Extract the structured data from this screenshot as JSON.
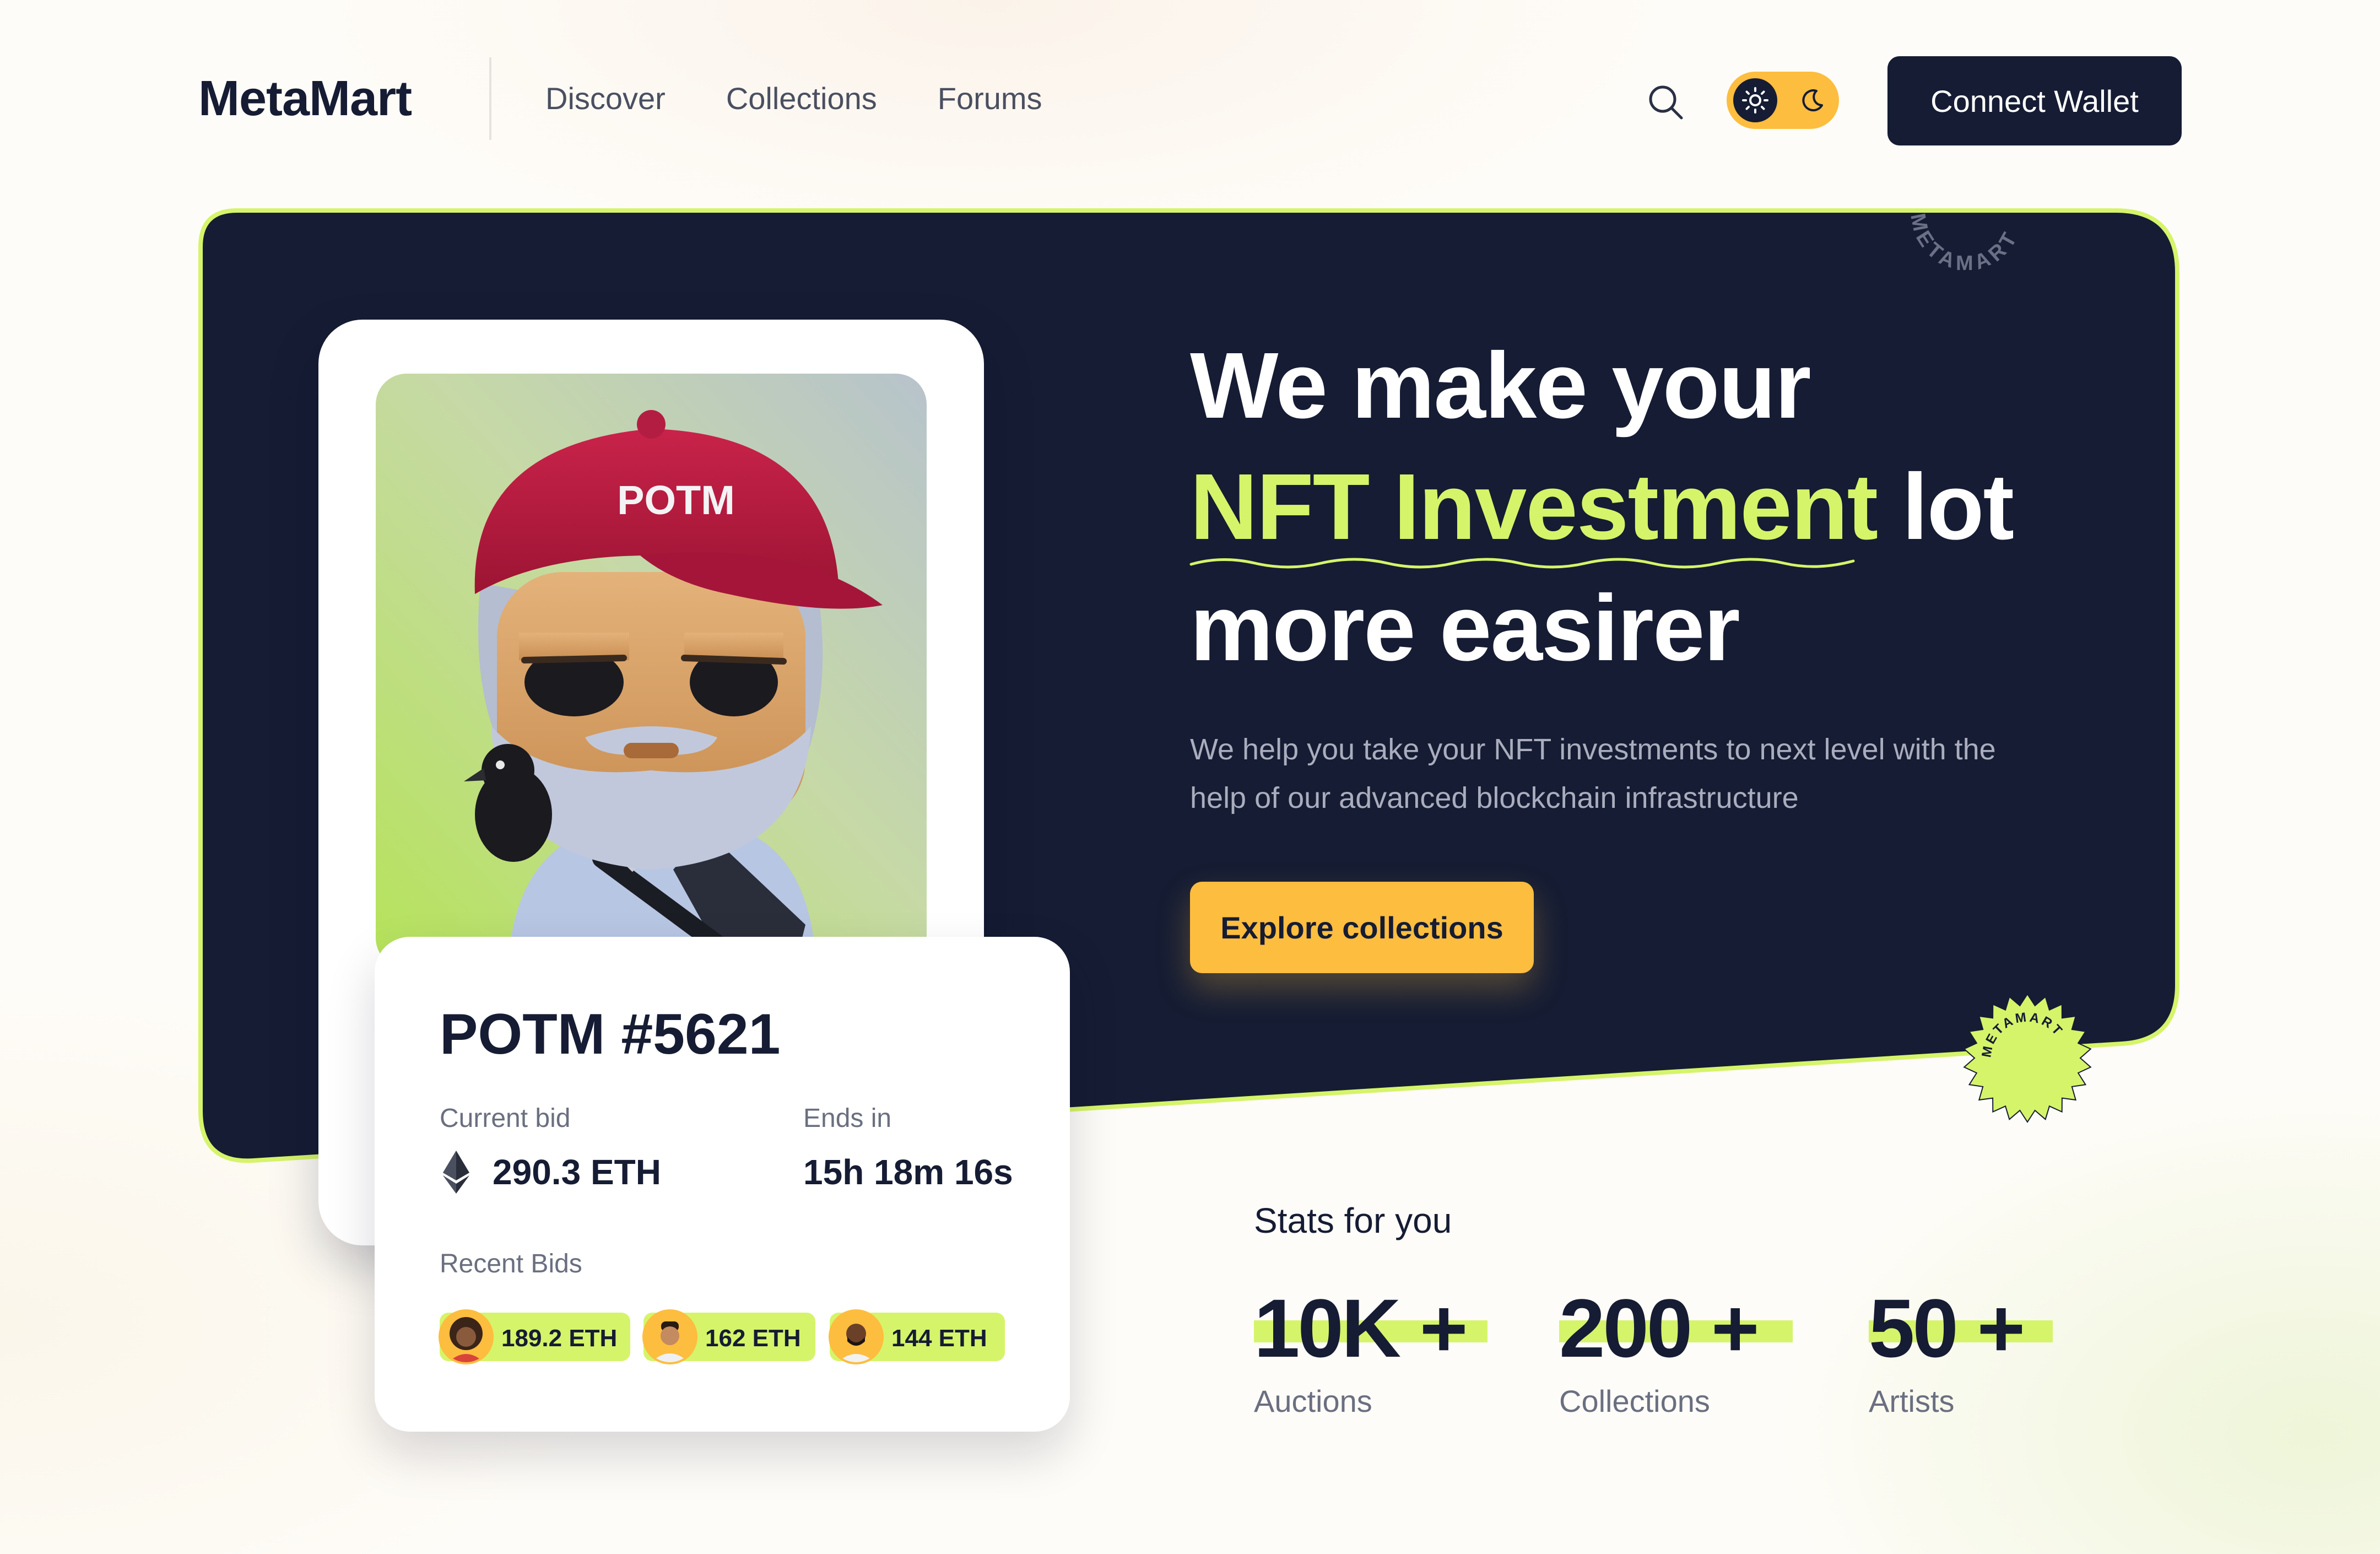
{
  "brand": "MetaMart",
  "nav": {
    "links": [
      "Discover",
      "Collections",
      "Forums"
    ]
  },
  "header": {
    "connect_label": "Connect Wallet"
  },
  "hero": {
    "title_line1": "We make your",
    "title_highlight": "NFT Investment",
    "title_line2_rest": "lot",
    "title_line3": "more easirer",
    "subtitle": "We help you take your NFT investments to next level with the help of our advanced blockchain infrastructure",
    "cta_label": "Explore collections",
    "badge_text": "METAMART"
  },
  "nft": {
    "cap_text": "POTM",
    "name": "POTM #5621",
    "current_bid_label": "Current bid",
    "current_bid_value": "290.3 ETH",
    "ends_in_label": "Ends in",
    "ends_in_value": "15h 18m 16s",
    "recent_bids_label": "Recent Bids",
    "recent_bids": [
      "189.2 ETH",
      "162 ETH",
      "144 ETH"
    ]
  },
  "stats": {
    "title": "Stats for you",
    "items": [
      {
        "value": "10K +",
        "label": "Auctions"
      },
      {
        "value": "200 +",
        "label": "Collections"
      },
      {
        "value": "50 +",
        "label": "Artists"
      }
    ]
  },
  "colors": {
    "navy": "#151c33",
    "lime": "#d5f46a",
    "amber": "#fdbd3f"
  }
}
